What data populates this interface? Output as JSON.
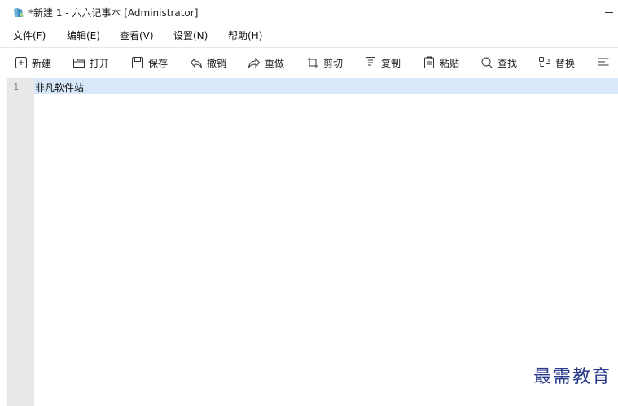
{
  "window": {
    "title": "*新建 1 - 六六记事本 [Administrator]",
    "app_icon": "notepad-app-icon"
  },
  "menu": [
    {
      "label": "文件(F)"
    },
    {
      "label": "编辑(E)"
    },
    {
      "label": "查看(V)"
    },
    {
      "label": "设置(N)"
    },
    {
      "label": "帮助(H)"
    }
  ],
  "toolbar": [
    {
      "label": "新建",
      "icon": "new-file-icon"
    },
    {
      "label": "打开",
      "icon": "folder-open-icon"
    },
    {
      "label": "保存",
      "icon": "save-icon"
    },
    {
      "label": "撤销",
      "icon": "undo-icon"
    },
    {
      "label": "重做",
      "icon": "redo-icon"
    },
    {
      "label": "剪切",
      "icon": "cut-icon"
    },
    {
      "label": "复制",
      "icon": "copy-icon"
    },
    {
      "label": "粘贴",
      "icon": "paste-icon"
    },
    {
      "label": "查找",
      "icon": "search-icon"
    },
    {
      "label": "替换",
      "icon": "replace-icon"
    }
  ],
  "editor": {
    "lines": [
      {
        "number": "1",
        "text": "非凡软件站"
      }
    ],
    "current_line_color": "#d8e8fa",
    "gutter_color": "#e8e8e8"
  },
  "watermark": "最需教育"
}
